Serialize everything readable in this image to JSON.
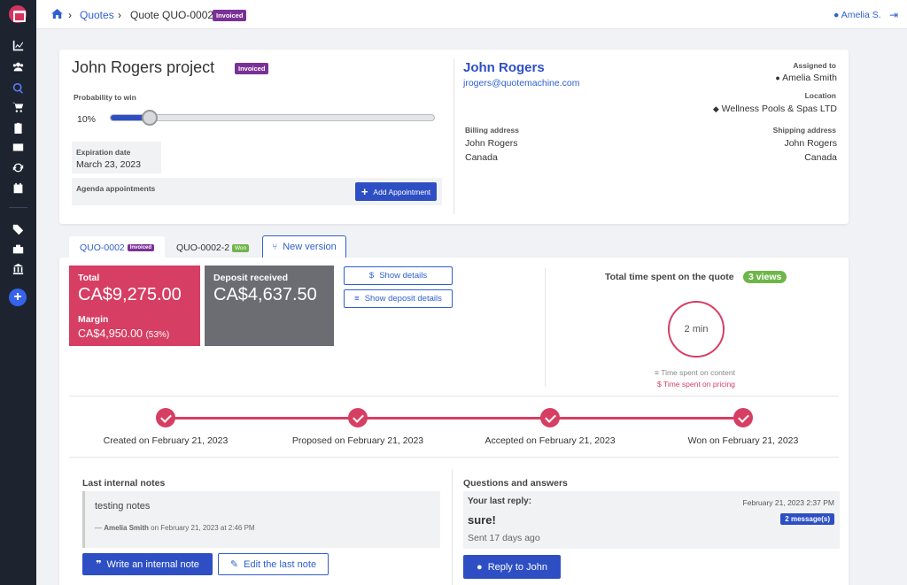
{
  "sidebar": {
    "icons": [
      "logo-icon",
      "chart-icon",
      "users-icon",
      "quotes-icon",
      "cart-icon",
      "clipboard-icon",
      "id-card-icon",
      "sync-icon",
      "calendar-icon",
      "tags-icon",
      "briefcase-icon",
      "bank-icon",
      "add-icon"
    ]
  },
  "breadcrumb": {
    "home_icon": "home-icon",
    "quotes": "Quotes",
    "current": "Quote QUO-0002",
    "badge": "Invoiced"
  },
  "user": {
    "name": "Amelia S."
  },
  "project": {
    "title": "John Rogers project",
    "badge": "Invoiced",
    "probability_label": "Probability to win",
    "probability_value": "10%",
    "probability_fraction": 0.12,
    "expiration_label": "Expiration date",
    "expiration_value": "March 23, 2023",
    "agenda_label": "Agenda appointments",
    "add_appointment": "Add Appointment"
  },
  "client": {
    "name": "John Rogers",
    "email": "jrogers@quotemachine.com",
    "assigned_label": "Assigned to",
    "assigned_value": "Amelia Smith",
    "location_label": "Location",
    "location_value": "Wellness Pools & Spas LTD",
    "billing_label": "Billing address",
    "billing_name": "John Rogers",
    "billing_country": "Canada",
    "shipping_label": "Shipping address",
    "shipping_name": "John Rogers",
    "shipping_country": "Canada"
  },
  "tabs": [
    {
      "label": "QUO-0002",
      "badge": "Invoiced"
    },
    {
      "label": "QUO-0002-2",
      "badge": "Won"
    },
    {
      "label": "New version"
    }
  ],
  "totals": {
    "total_label": "Total",
    "total_value": "CA$9,275.00",
    "margin_label": "Margin",
    "margin_value": "CA$4,950.00",
    "margin_pct": "(53%)",
    "deposit_label": "Deposit received",
    "deposit_value": "CA$4,637.50",
    "show_details": "Show details",
    "show_deposit_details": "Show deposit details"
  },
  "time": {
    "title": "Total time spent on the quote",
    "views": "3 views",
    "minutes": "2 min",
    "legend_content": "Time spent on content",
    "legend_pricing": "Time spent on pricing"
  },
  "timeline": [
    "Created on February 21, 2023",
    "Proposed on February 21, 2023",
    "Accepted on February 21, 2023",
    "Won on February 21, 2023"
  ],
  "notes": {
    "title": "Last internal notes",
    "text": "testing notes",
    "author": "Amelia Smith",
    "meta_prefix": "—",
    "meta_suffix": "on February 21, 2023 at 2:46 PM",
    "write_btn": "Write an internal note",
    "edit_btn": "Edit the last note"
  },
  "qa": {
    "title": "Questions and answers",
    "last_reply_label": "Your last reply:",
    "timestamp": "February 21, 2023 2:37 PM",
    "message": "sure!",
    "count_badge": "2 message(s)",
    "sent": "Sent 17 days ago",
    "reply_btn": "Reply to John"
  },
  "colors": {
    "sidebar": "#1d2430",
    "primary": "#2e4fc4",
    "total_card": "#d63e63",
    "deposit_card": "#6b6d73",
    "invoiced_badge": "#7a3196",
    "won_badge": "#6fb64a",
    "views_badge": "#6fb64a"
  }
}
